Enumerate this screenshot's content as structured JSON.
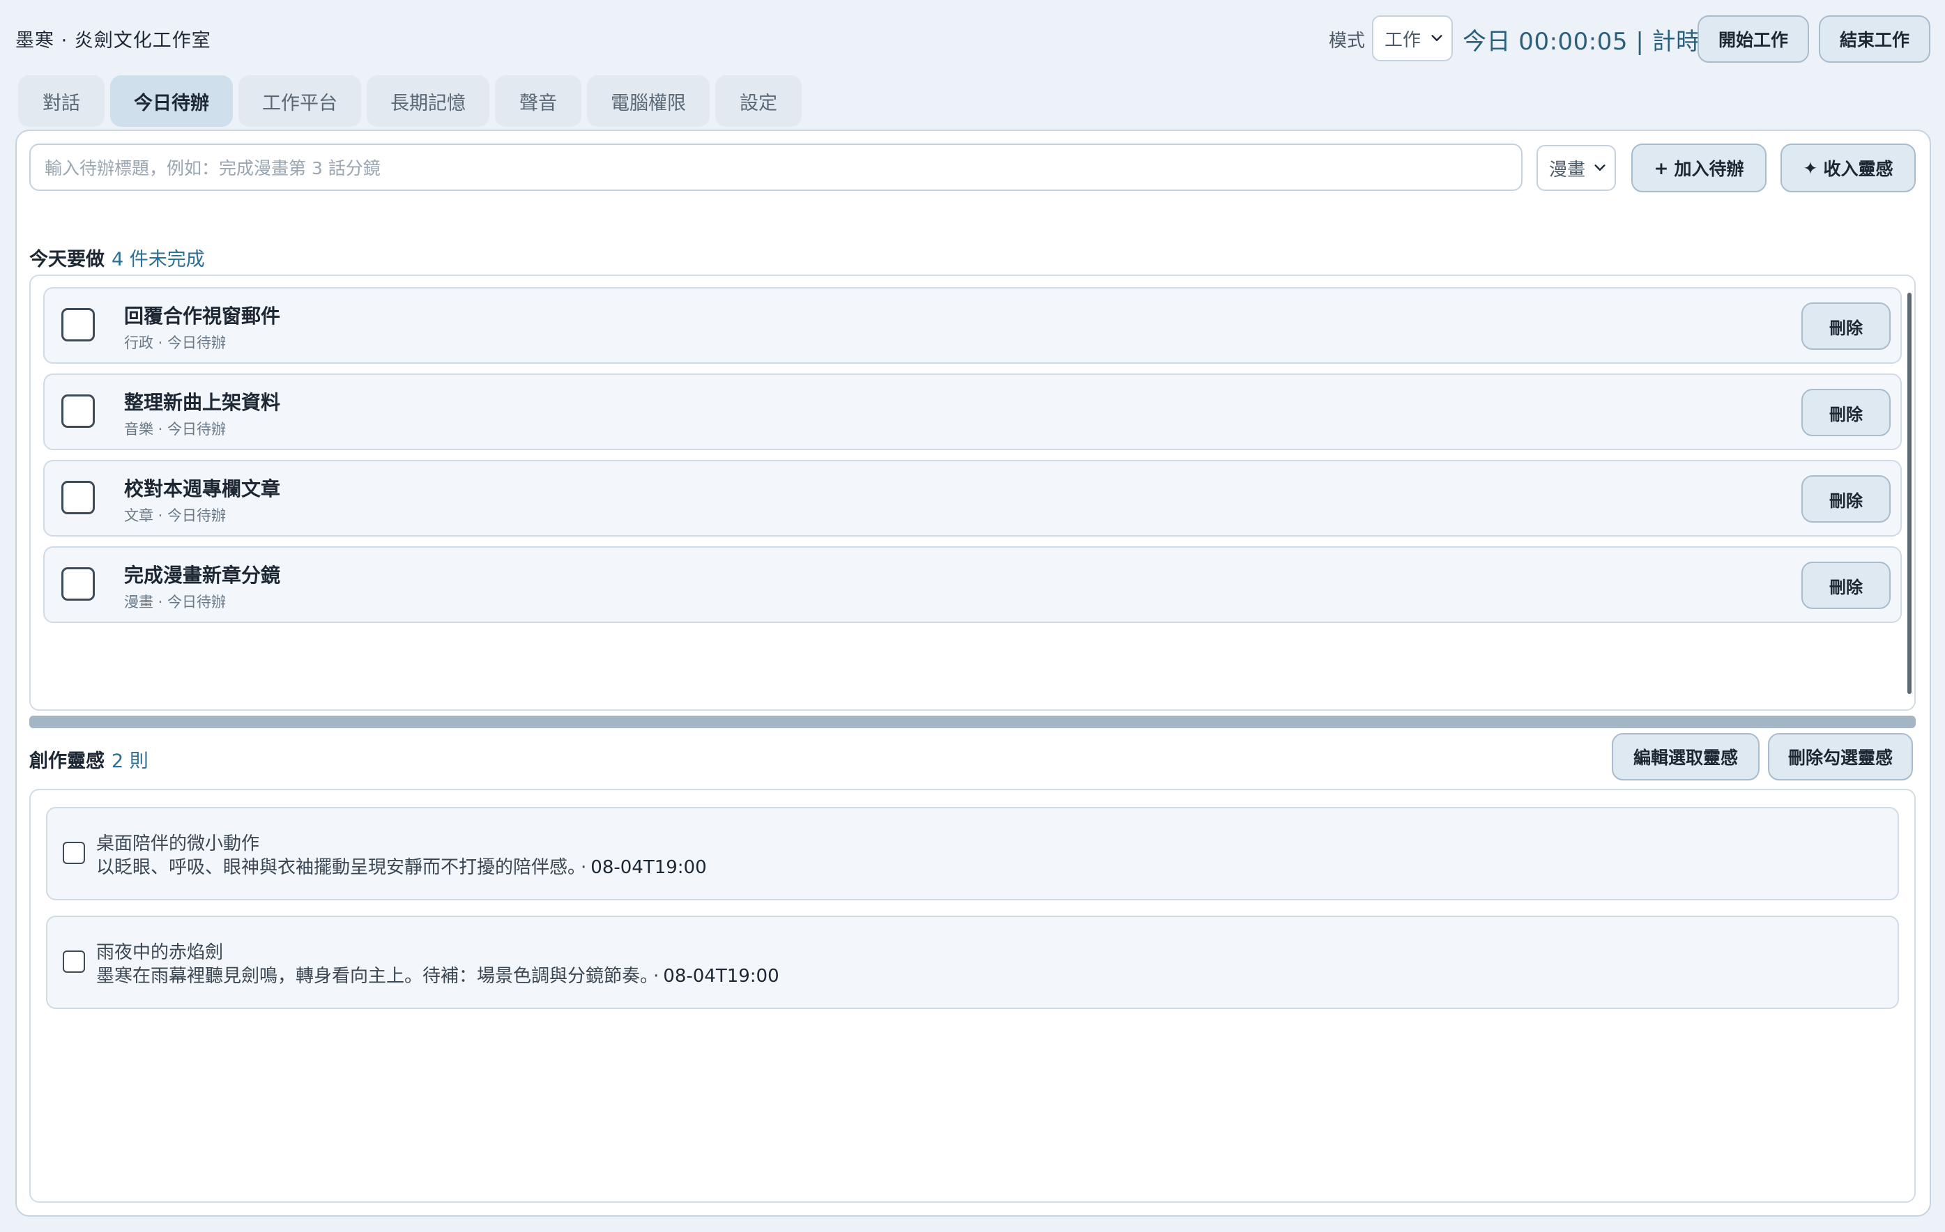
{
  "app": {
    "title": "墨寒 · 炎劍文化工作室"
  },
  "header": {
    "mode_label": "模式",
    "mode_value": "工作",
    "timer_text": "今日 00:00:05 | 計時中",
    "start_label": "開始工作",
    "end_label": "結束工作"
  },
  "tabs": [
    {
      "label": "對話",
      "active": false
    },
    {
      "label": "今日待辦",
      "active": true
    },
    {
      "label": "工作平台",
      "active": false
    },
    {
      "label": "長期記憶",
      "active": false
    },
    {
      "label": "聲音",
      "active": false
    },
    {
      "label": "電腦權限",
      "active": false
    },
    {
      "label": "設定",
      "active": false
    }
  ],
  "todo_input": {
    "placeholder": "輸入待辦標題，例如：完成漫畫第 3 話分鏡",
    "category_value": "漫畫",
    "add_icon": "+",
    "add_label": "加入待辦",
    "inspire_icon": "✦",
    "inspire_label": "收入靈感"
  },
  "today": {
    "heading": "今天要做",
    "count_text": "4 件未完成",
    "delete_label": "刪除",
    "items": [
      {
        "title": "回覆合作視窗郵件",
        "meta": "行政 · 今日待辦"
      },
      {
        "title": "整理新曲上架資料",
        "meta": "音樂 · 今日待辦"
      },
      {
        "title": "校對本週專欄文章",
        "meta": "文章 · 今日待辦"
      },
      {
        "title": "完成漫畫新章分鏡",
        "meta": "漫畫 · 今日待辦"
      }
    ]
  },
  "ideas": {
    "heading": "創作靈感",
    "count_text": "2 則",
    "edit_label": "編輯選取靈感",
    "delete_label": "刪除勾選靈感",
    "items": [
      {
        "title": "桌面陪伴的微小動作",
        "body": "以眨眼、呼吸、眼神與衣袖擺動呈現安靜而不打擾的陪伴感。",
        "sep": "·",
        "time": "08-04T19:00"
      },
      {
        "title": "雨夜中的赤焰劍",
        "body": "墨寒在雨幕裡聽見劍鳴，轉身看向主上。待補：場景色調與分鏡節奏。",
        "sep": "·",
        "time": "08-04T19:00"
      }
    ]
  },
  "colors": {
    "background": "#edf2f8",
    "accent": "#2c6f96",
    "button_bg": "#dfe9f2",
    "active_tab": "#cfe0ec"
  }
}
